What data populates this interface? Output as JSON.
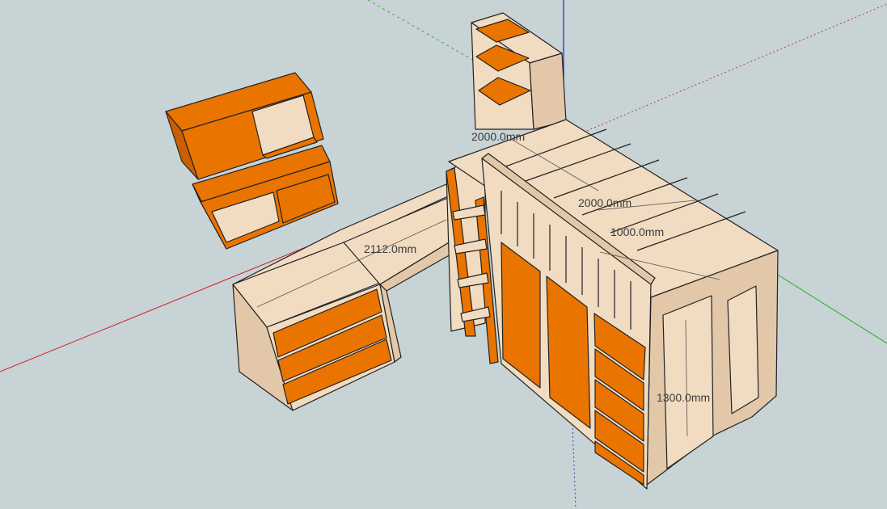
{
  "scene": {
    "background": "#c8d3d6",
    "colors": {
      "orange": "#ea7400",
      "orange_dark": "#c95f00",
      "wood": "#f1dcc2",
      "wood_shadow": "#e2c8a8",
      "wood_dark": "#cfb08c",
      "axis_red": "#d02020",
      "axis_green": "#22aa22",
      "axis_blue": "#2233cc",
      "outline": "#222222"
    }
  },
  "dimensions": {
    "bookshelf_top": "2000.0mm",
    "bed_length": "2000.0mm",
    "bed_width": "1000.0mm",
    "desk_length": "2112.0mm",
    "bed_height": "1300.0mm"
  }
}
